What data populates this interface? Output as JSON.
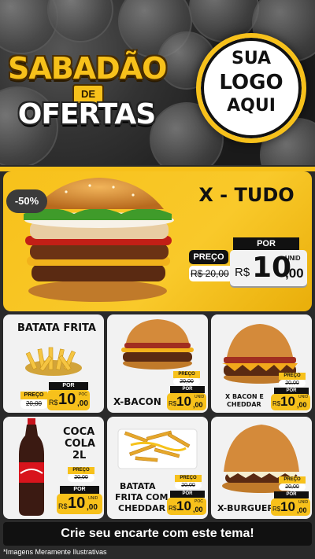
{
  "hero": {
    "title_line1": "SABADÃO",
    "title_de": "DE",
    "title_line2": "OFERTAS",
    "logo_line1": "SUA",
    "logo_line2": "LOGO",
    "logo_line3": "AQUI"
  },
  "featured": {
    "discount": "-50%",
    "name": "X - TUDO",
    "por_label": "POR",
    "preco_label": "PREÇO",
    "old_price": "R$ 20,00",
    "currency": "R$",
    "price_int": "10",
    "price_dec": ",00",
    "unit": "UNID"
  },
  "products": [
    {
      "name": "BATATA FRITA",
      "preco_label": "PREÇO",
      "old_price": "20,00",
      "por_label": "POR",
      "currency": "R$",
      "price_int": "10",
      "price_dec": ",00",
      "unit": "POC"
    },
    {
      "name": "X-BACON",
      "preco_label": "PREÇO",
      "old_price": "20,00",
      "por_label": "POR",
      "currency": "R$",
      "price_int": "10",
      "price_dec": ",00",
      "unit": "UNID"
    },
    {
      "name_line1": "X BACON E",
      "name_line2": "CHEDDAR",
      "preco_label": "PREÇO",
      "old_price": "20,00",
      "por_label": "POR",
      "currency": "R$",
      "price_int": "10",
      "price_dec": ",00",
      "unit": "UNID"
    },
    {
      "name_line1": "COCA",
      "name_line2": "COLA",
      "name_line3": "2L",
      "preco_label": "PREÇO",
      "old_price": "20,00",
      "por_label": "POR",
      "currency": "R$",
      "price_int": "10",
      "price_dec": ",00",
      "unit": "UNID"
    },
    {
      "name_line1": "BATATA",
      "name_line2": "FRITA COM",
      "name_line3": "CHEDDAR",
      "preco_label": "PREÇO",
      "old_price": "20,00",
      "por_label": "POR",
      "currency": "R$",
      "price_int": "10",
      "price_dec": ",00",
      "unit": "POC"
    },
    {
      "name": "X-BURGUER",
      "preco_label": "PREÇO",
      "old_price": "20,00",
      "por_label": "POR",
      "currency": "R$",
      "price_int": "10",
      "price_dec": ",00",
      "unit": "UNID"
    }
  ],
  "footer": {
    "cta": "Crie seu encarte com este tema!",
    "disclaimer": "*Imagens Meramente Ilustrativas"
  },
  "colors": {
    "accent": "#f7c11b",
    "dark": "#111111",
    "card": "#f2f2f2",
    "coke_red": "#d8141c"
  },
  "icons": [
    "burger-image",
    "fries-image",
    "coke-bottle-image",
    "cheese-fries-image"
  ]
}
